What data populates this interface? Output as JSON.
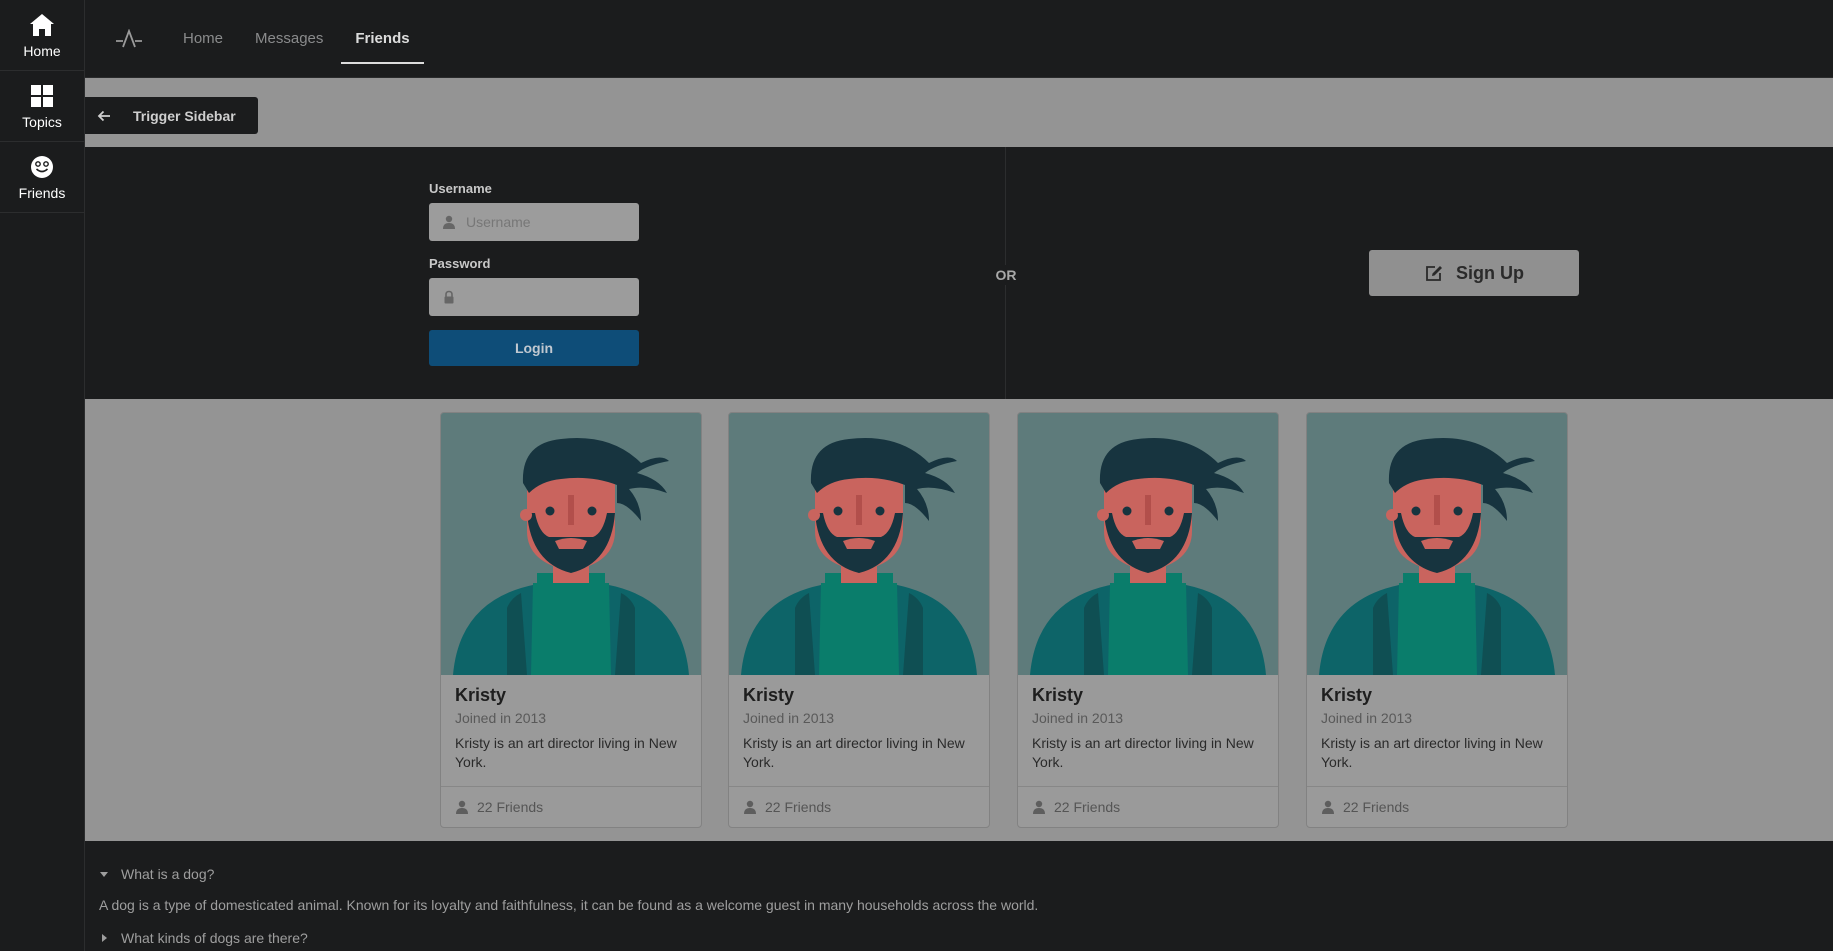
{
  "sidebar": {
    "items": [
      {
        "label": "Home",
        "icon": "home-icon"
      },
      {
        "label": "Topics",
        "icon": "grid-icon"
      },
      {
        "label": "Friends",
        "icon": "smile-icon"
      }
    ]
  },
  "topmenu": {
    "logo": "logo-icon",
    "items": [
      {
        "label": "Home",
        "active": false
      },
      {
        "label": "Messages",
        "active": false
      },
      {
        "label": "Friends",
        "active": true
      }
    ]
  },
  "trigger": {
    "label": "Trigger Sidebar",
    "icon": "arrow-left-icon"
  },
  "login": {
    "username_label": "Username",
    "username_placeholder": "Username",
    "username_value": "",
    "password_label": "Password",
    "password_value": "",
    "login_button": "Login",
    "or_text": "OR",
    "signup_button": "Sign Up",
    "login_color": "#0e4d78"
  },
  "cards": [
    {
      "name": "Kristy",
      "meta": "Joined in 2013",
      "description": "Kristy is an art director living in New York.",
      "friends": "22 Friends"
    },
    {
      "name": "Kristy",
      "meta": "Joined in 2013",
      "description": "Kristy is an art director living in New York.",
      "friends": "22 Friends"
    },
    {
      "name": "Kristy",
      "meta": "Joined in 2013",
      "description": "Kristy is an art director living in New York.",
      "friends": "22 Friends"
    },
    {
      "name": "Kristy",
      "meta": "Joined in 2013",
      "description": "Kristy is an art director living in New York.",
      "friends": "22 Friends"
    }
  ],
  "accordion": [
    {
      "title": "What is a dog?",
      "open": true,
      "content": "A dog is a type of domesticated animal. Known for its loyalty and faithfulness, it can be found as a welcome guest in many households across the world."
    },
    {
      "title": "What kinds of dogs are there?",
      "open": false
    }
  ]
}
